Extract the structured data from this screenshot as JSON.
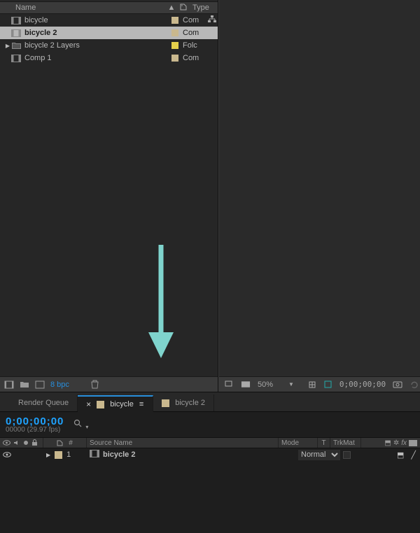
{
  "project": {
    "columns": {
      "name": "Name",
      "type": "Type"
    },
    "items": [
      {
        "label": "bicycle",
        "kind": "comp",
        "swatch": "#c9b88e",
        "type": "Com",
        "link": true,
        "selected": false,
        "indent": 0
      },
      {
        "label": "bicycle 2",
        "kind": "comp",
        "swatch": "#c9b88e",
        "type": "Com",
        "link": false,
        "selected": true,
        "indent": 0
      },
      {
        "label": "bicycle 2 Layers",
        "kind": "folder",
        "swatch": "#e4cf4b",
        "type": "Folc",
        "link": false,
        "selected": false,
        "indent": 0,
        "twirl": true
      },
      {
        "label": "Comp 1",
        "kind": "comp",
        "swatch": "#c9b88e",
        "type": "Com",
        "link": false,
        "selected": false,
        "indent": 0
      }
    ],
    "bottom": {
      "bpc": "8 bpc"
    }
  },
  "viewer": {
    "zoom": "50%",
    "timecode": "0;00;00;00"
  },
  "timeline": {
    "tabs": [
      {
        "label": "Render Queue",
        "active": false,
        "icon": false
      },
      {
        "label": "bicycle",
        "active": true,
        "icon": true
      },
      {
        "label": "bicycle 2",
        "active": false,
        "icon": true
      }
    ],
    "current_time": "0;00;00;00",
    "frame_info": "00000 (29.97 fps)",
    "col": {
      "num": "#",
      "source": "Source Name",
      "mode": "Mode",
      "t": "T",
      "trkmat": "TrkMat"
    },
    "layers": [
      {
        "num": "1",
        "label": "bicycle 2",
        "swatch": "#c9b88e",
        "mode": "Normal"
      }
    ]
  }
}
